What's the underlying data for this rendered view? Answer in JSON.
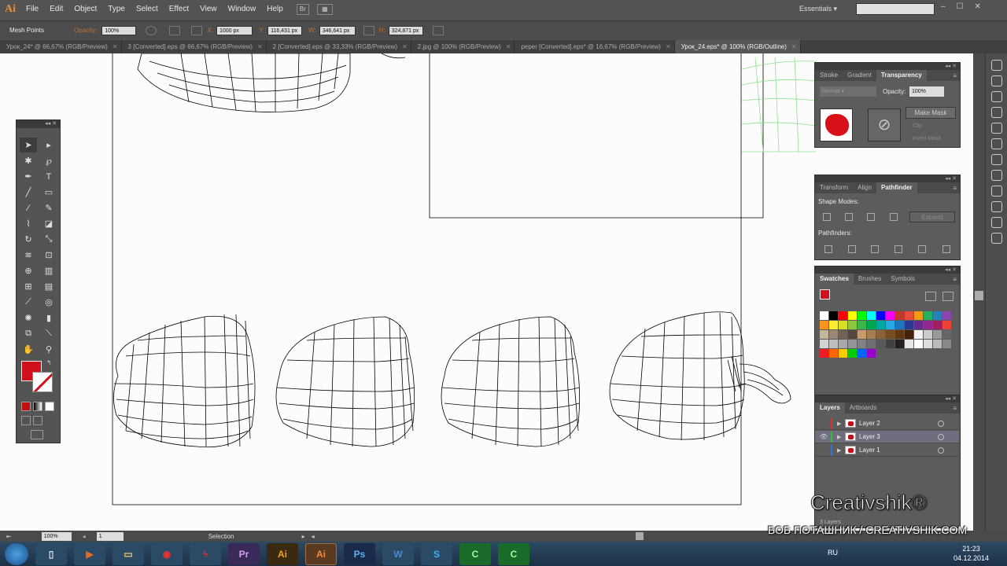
{
  "app": {
    "logo": "Ai"
  },
  "menu": [
    "File",
    "Edit",
    "Object",
    "Type",
    "Select",
    "Effect",
    "View",
    "Window",
    "Help"
  ],
  "bridge_label": "Br",
  "workspace": "Essentials",
  "control": {
    "mode": "Mesh Points",
    "opacity_label": "Opacity:",
    "opacity": "100%",
    "x_label": "X:",
    "x": "1000 px",
    "y_label": "Y:",
    "y": "116,431 px",
    "w_label": "W:",
    "w": "346,641 px",
    "h_label": "H:",
    "h": "324,871 px"
  },
  "tabs": [
    {
      "label": "Урок_24* @ 66,67% (RGB/Preview)",
      "active": false
    },
    {
      "label": "3 [Converted].eps @ 66,67% (RGB/Preview)",
      "active": false
    },
    {
      "label": "2 [Converted].eps @ 33,33% (RGB/Preview)",
      "active": false
    },
    {
      "label": "2.jpg @ 100% (RGB/Preview)",
      "active": false
    },
    {
      "label": "peper [Converted].eps* @ 16,67% (RGB/Preview)",
      "active": false
    },
    {
      "label": "Урок_24.eps* @ 100% (RGB/Outline)",
      "active": true
    }
  ],
  "transparency_panel": {
    "tabs": [
      "Stroke",
      "Gradient",
      "Transparency"
    ],
    "blend_mode": "Normal",
    "opacity_label": "Opacity:",
    "opacity": "100%",
    "make_mask": "Make Mask",
    "clip": "Clip",
    "invert_mask": "Invert Mask"
  },
  "pathfinder_panel": {
    "tabs": [
      "Transform",
      "Align",
      "Pathfinder"
    ],
    "shape_modes": "Shape Modes:",
    "expand": "Expand",
    "pathfinders": "Pathfinders:"
  },
  "swatches_panel": {
    "tabs": [
      "Swatches",
      "Brushes",
      "Symbols"
    ],
    "colors": [
      "#ffffff",
      "#000000",
      "#ff0000",
      "#ffff00",
      "#00ff00",
      "#00ffff",
      "#0000ff",
      "#ff00ff",
      "#c0392b",
      "#e74c3c",
      "#f39c12",
      "#27ae60",
      "#2980b9",
      "#8e44ad",
      "#f7941d",
      "#f9ed32",
      "#d7df23",
      "#8dc63f",
      "#39b54a",
      "#00a651",
      "#00a99d",
      "#27aae1",
      "#1c75bc",
      "#2b3990",
      "#662d91",
      "#92278f",
      "#9e1f63",
      "#ef4136",
      "#c2b59b",
      "#998675",
      "#736357",
      "#534741",
      "#c69c6d",
      "#a67c52",
      "#8c6239",
      "#754c24",
      "#603913",
      "#42210b",
      "#f2f2f2",
      "#cccccc",
      "#999999",
      "#666666",
      "#d1d3d4",
      "#bcbec0",
      "#a7a9ac",
      "#939598",
      "#808285",
      "#6d6e71",
      "#58595b",
      "#414042",
      "#231f20",
      "#e6e7e8",
      "#ffffff",
      "#dddddd",
      "#bbbbbb",
      "#888888",
      "#ed1c24",
      "#ff6600",
      "#ffcc00",
      "#00cc00",
      "#0066ff",
      "#9900cc"
    ]
  },
  "layers_panel": {
    "tabs": [
      "Layers",
      "Artboards"
    ],
    "layers": [
      {
        "name": "Layer 2",
        "color": "#e03030",
        "visible": false,
        "selected": false
      },
      {
        "name": "Layer 3",
        "color": "#30c030",
        "visible": true,
        "selected": true
      },
      {
        "name": "Layer 1",
        "color": "#3070e0",
        "visible": false,
        "selected": false
      }
    ],
    "count": "3 Layers"
  },
  "status": {
    "zoom": "100%",
    "artboard": "1",
    "tool": "Selection"
  },
  "taskbar": {
    "lang": "RU",
    "time": "21:23",
    "date": "04.12.2014"
  },
  "watermark": {
    "brand": "Creativshik®",
    "credit": "БОБ ПОТАШНИК / CREATIVSHIK.COM"
  }
}
